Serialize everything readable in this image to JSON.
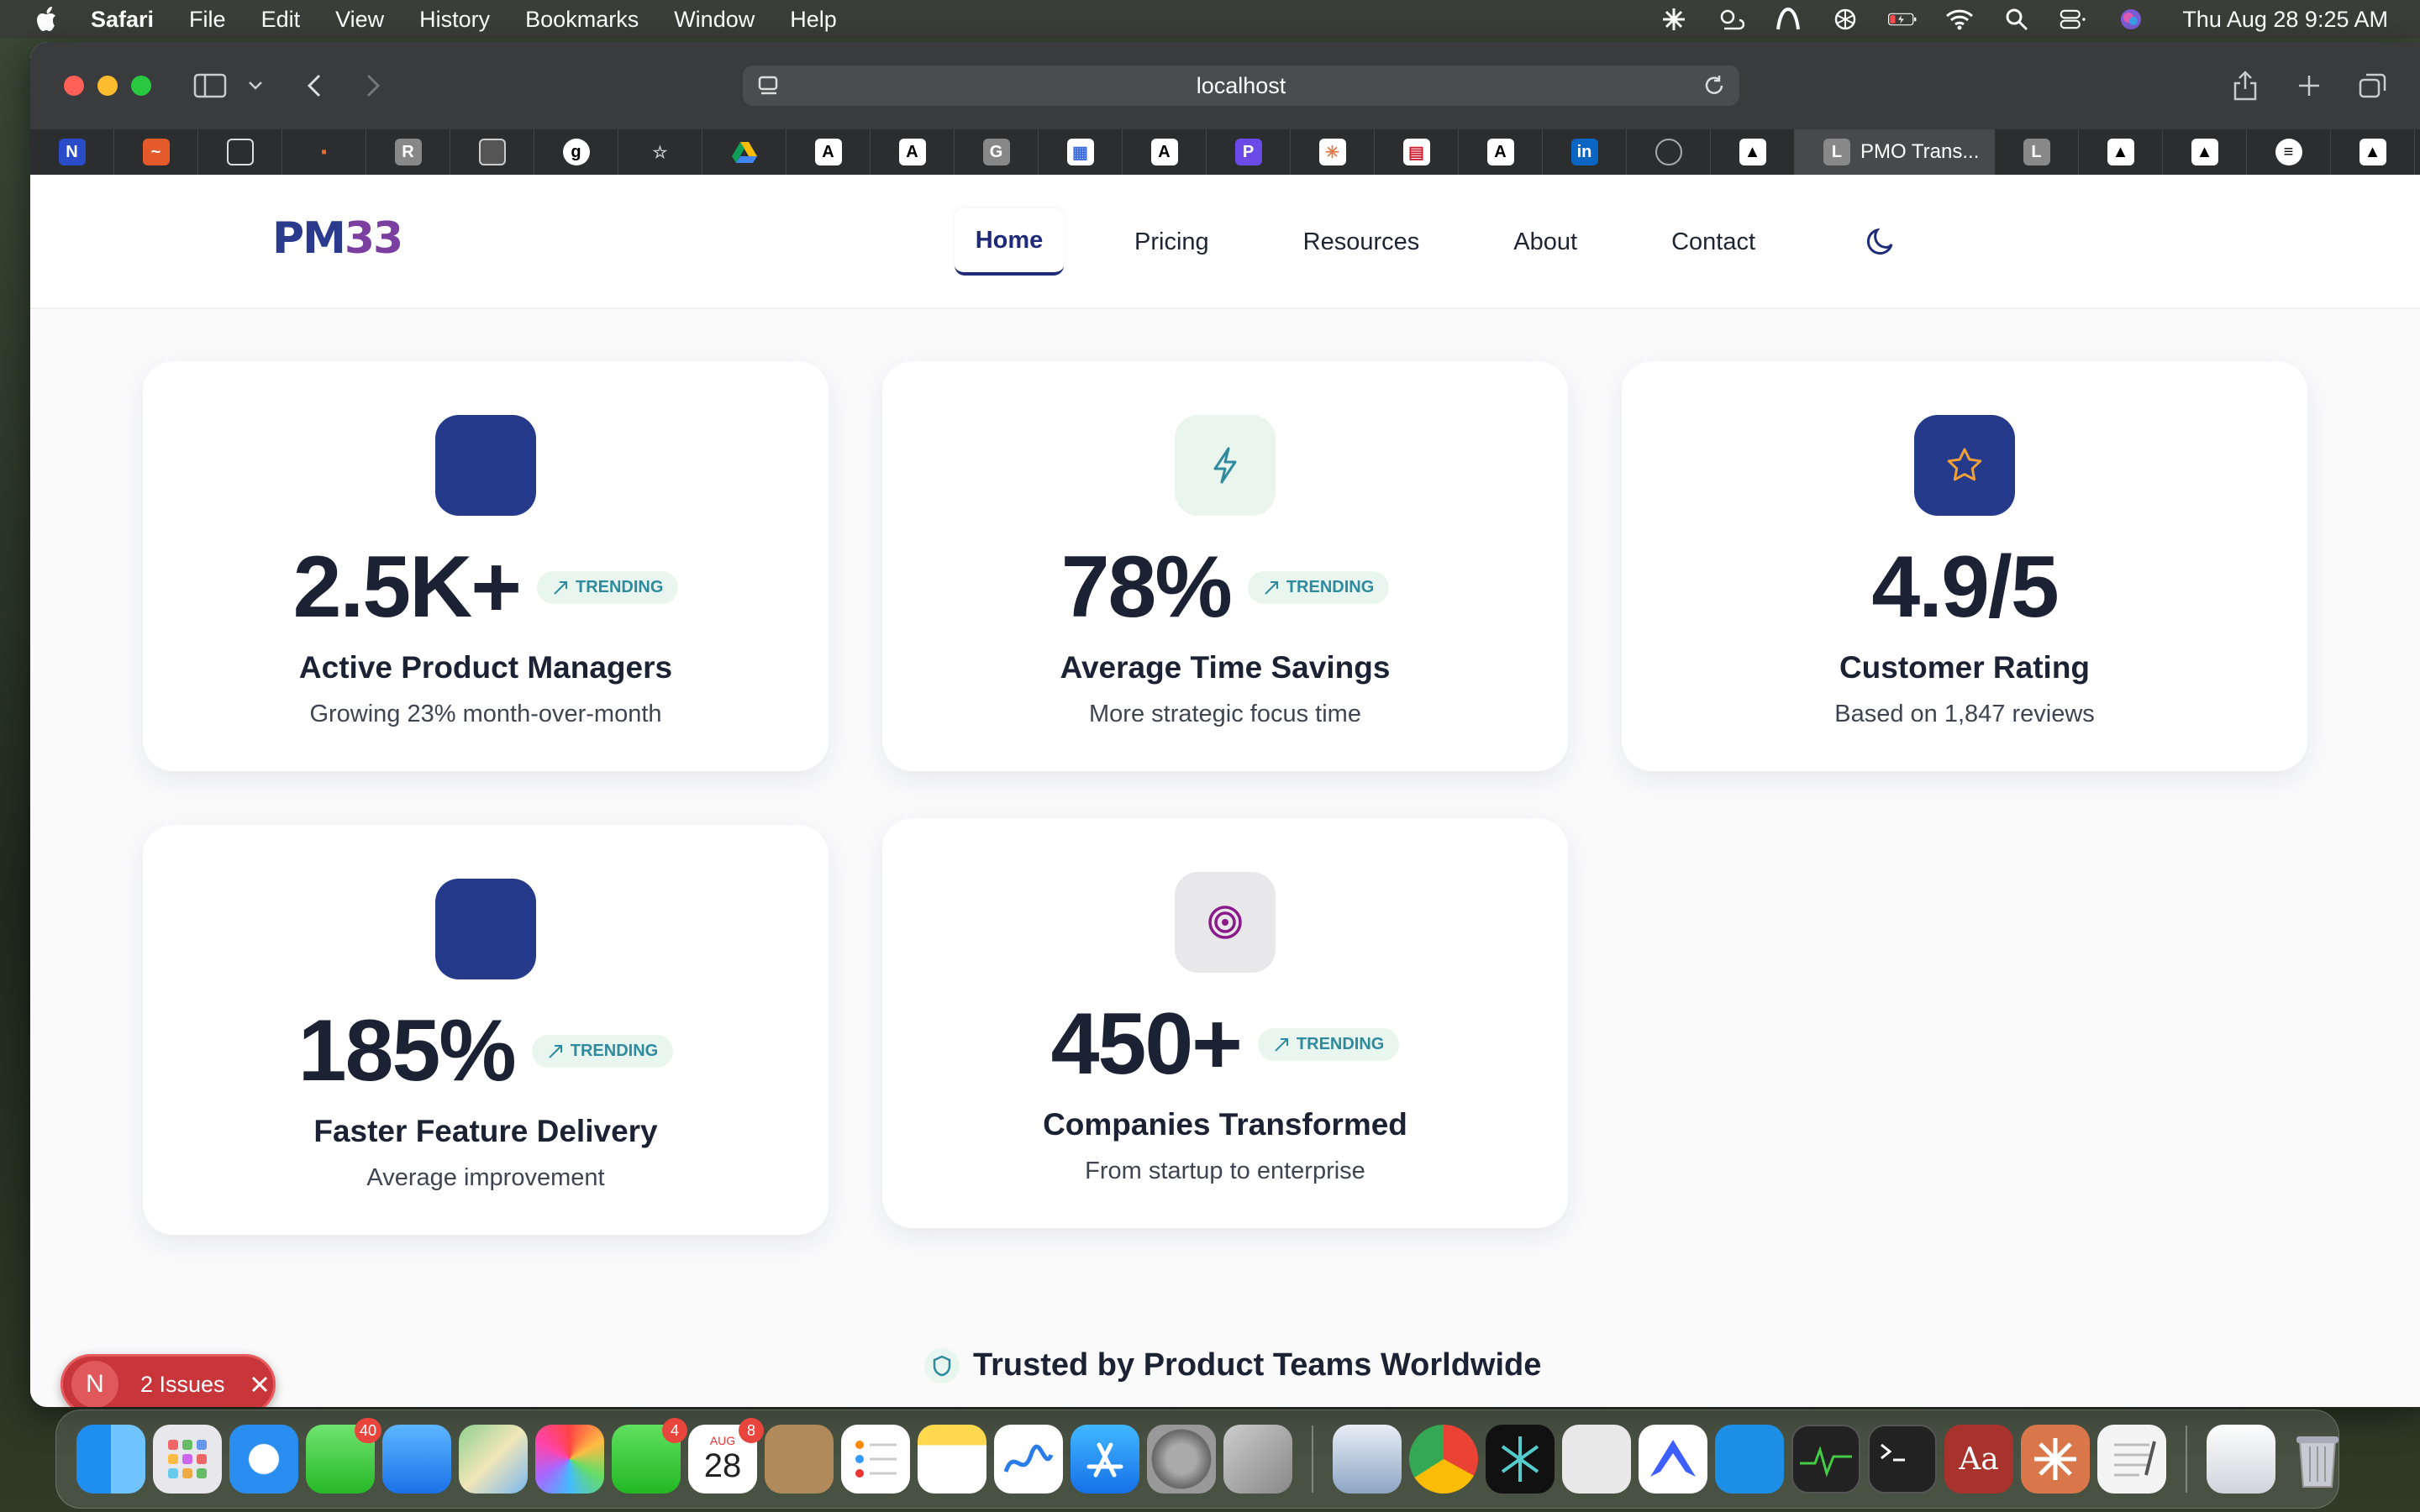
{
  "menubar": {
    "app_name": "Safari",
    "menus": [
      "File",
      "Edit",
      "View",
      "History",
      "Bookmarks",
      "Window",
      "Help"
    ],
    "clock": "Thu Aug 28  9:25 AM"
  },
  "browser": {
    "url": "localhost",
    "active_tab_title": "PMO Trans...",
    "active_tab_letter": "L",
    "tab_letters": [
      "",
      "",
      "",
      "",
      "R",
      "",
      "",
      "",
      "",
      "",
      "",
      "G",
      "",
      "",
      "",
      "",
      "",
      "",
      "",
      "",
      "",
      "L",
      "",
      "",
      "",
      ""
    ]
  },
  "site": {
    "logo_pm": "PM",
    "logo_num": "33",
    "nav": [
      "Home",
      "Pricing",
      "Resources",
      "About",
      "Contact"
    ]
  },
  "stats": [
    {
      "value": "2.5K+",
      "badge": "TRENDING",
      "label": "Active Product Managers",
      "sub": "Growing 23% month-over-month",
      "icon": "blank-icon",
      "icon_bg": "#263a8c"
    },
    {
      "value": "78%",
      "badge": "TRENDING",
      "label": "Average Time Savings",
      "sub": "More strategic focus time",
      "icon": "lightning-icon",
      "icon_bg": "#eaf5ee"
    },
    {
      "value": "4.9/5",
      "badge": "",
      "label": "Customer Rating",
      "sub": "Based on 1,847 reviews",
      "icon": "star-icon",
      "icon_bg": "#263a8c"
    },
    {
      "value": "185%",
      "badge": "TRENDING",
      "label": "Faster Feature Delivery",
      "sub": "Average improvement",
      "icon": "blank-icon",
      "icon_bg": "#263a8c"
    },
    {
      "value": "450+",
      "badge": "TRENDING",
      "label": "Companies Transformed",
      "sub": "From startup to enterprise",
      "icon": "target-icon",
      "icon_bg": "#e8e8ea"
    }
  ],
  "trusted_heading": "Trusted by Product Teams Worldwide",
  "issues_pill": {
    "letter": "N",
    "text": "2 Issues"
  },
  "dock": {
    "badges": {
      "messages": "40",
      "facetime": "4",
      "calendar": "8"
    },
    "calendar_month": "AUG",
    "calendar_day": "28"
  },
  "colors": {
    "brand_navy": "#263a8c",
    "trending_green": "#2f8a9e",
    "issues_red": "#c8353a"
  }
}
